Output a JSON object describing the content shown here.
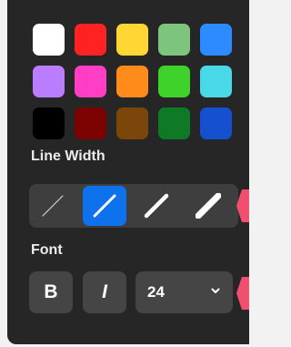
{
  "colors": {
    "panel_bg": "#262626",
    "group_bg": "#3e3e3e",
    "button_bg": "#454545",
    "accent": "#0e72ed",
    "marker": "#f0506e"
  },
  "swatches": [
    {
      "name": "white",
      "hex": "#ffffff"
    },
    {
      "name": "red",
      "hex": "#ff2222"
    },
    {
      "name": "yellow",
      "hex": "#ffd634"
    },
    {
      "name": "light-green",
      "hex": "#7dc47d"
    },
    {
      "name": "blue",
      "hex": "#2c8cff"
    },
    {
      "name": "lavender",
      "hex": "#bb7dff"
    },
    {
      "name": "pink",
      "hex": "#ff3dc5"
    },
    {
      "name": "orange",
      "hex": "#ff8b1a"
    },
    {
      "name": "green",
      "hex": "#3fd22a"
    },
    {
      "name": "cyan",
      "hex": "#48d8e8"
    },
    {
      "name": "black",
      "hex": "#000000"
    },
    {
      "name": "dark-red",
      "hex": "#7d0303"
    },
    {
      "name": "brown",
      "hex": "#7a4609"
    },
    {
      "name": "dark-green",
      "hex": "#0e7a26"
    },
    {
      "name": "dark-blue",
      "hex": "#1450cf"
    }
  ],
  "line_width": {
    "label": "Line Width",
    "options": [
      {
        "name": "thinnest",
        "stroke": 1.2
      },
      {
        "name": "thin",
        "stroke": 3
      },
      {
        "name": "medium",
        "stroke": 4.5
      },
      {
        "name": "thick",
        "stroke": 7
      }
    ],
    "selected_index": 1
  },
  "font": {
    "label": "Font",
    "bold_label": "B",
    "italic_label": "I",
    "size_value": "24",
    "dropdown_icon": "chevron-down-icon"
  }
}
